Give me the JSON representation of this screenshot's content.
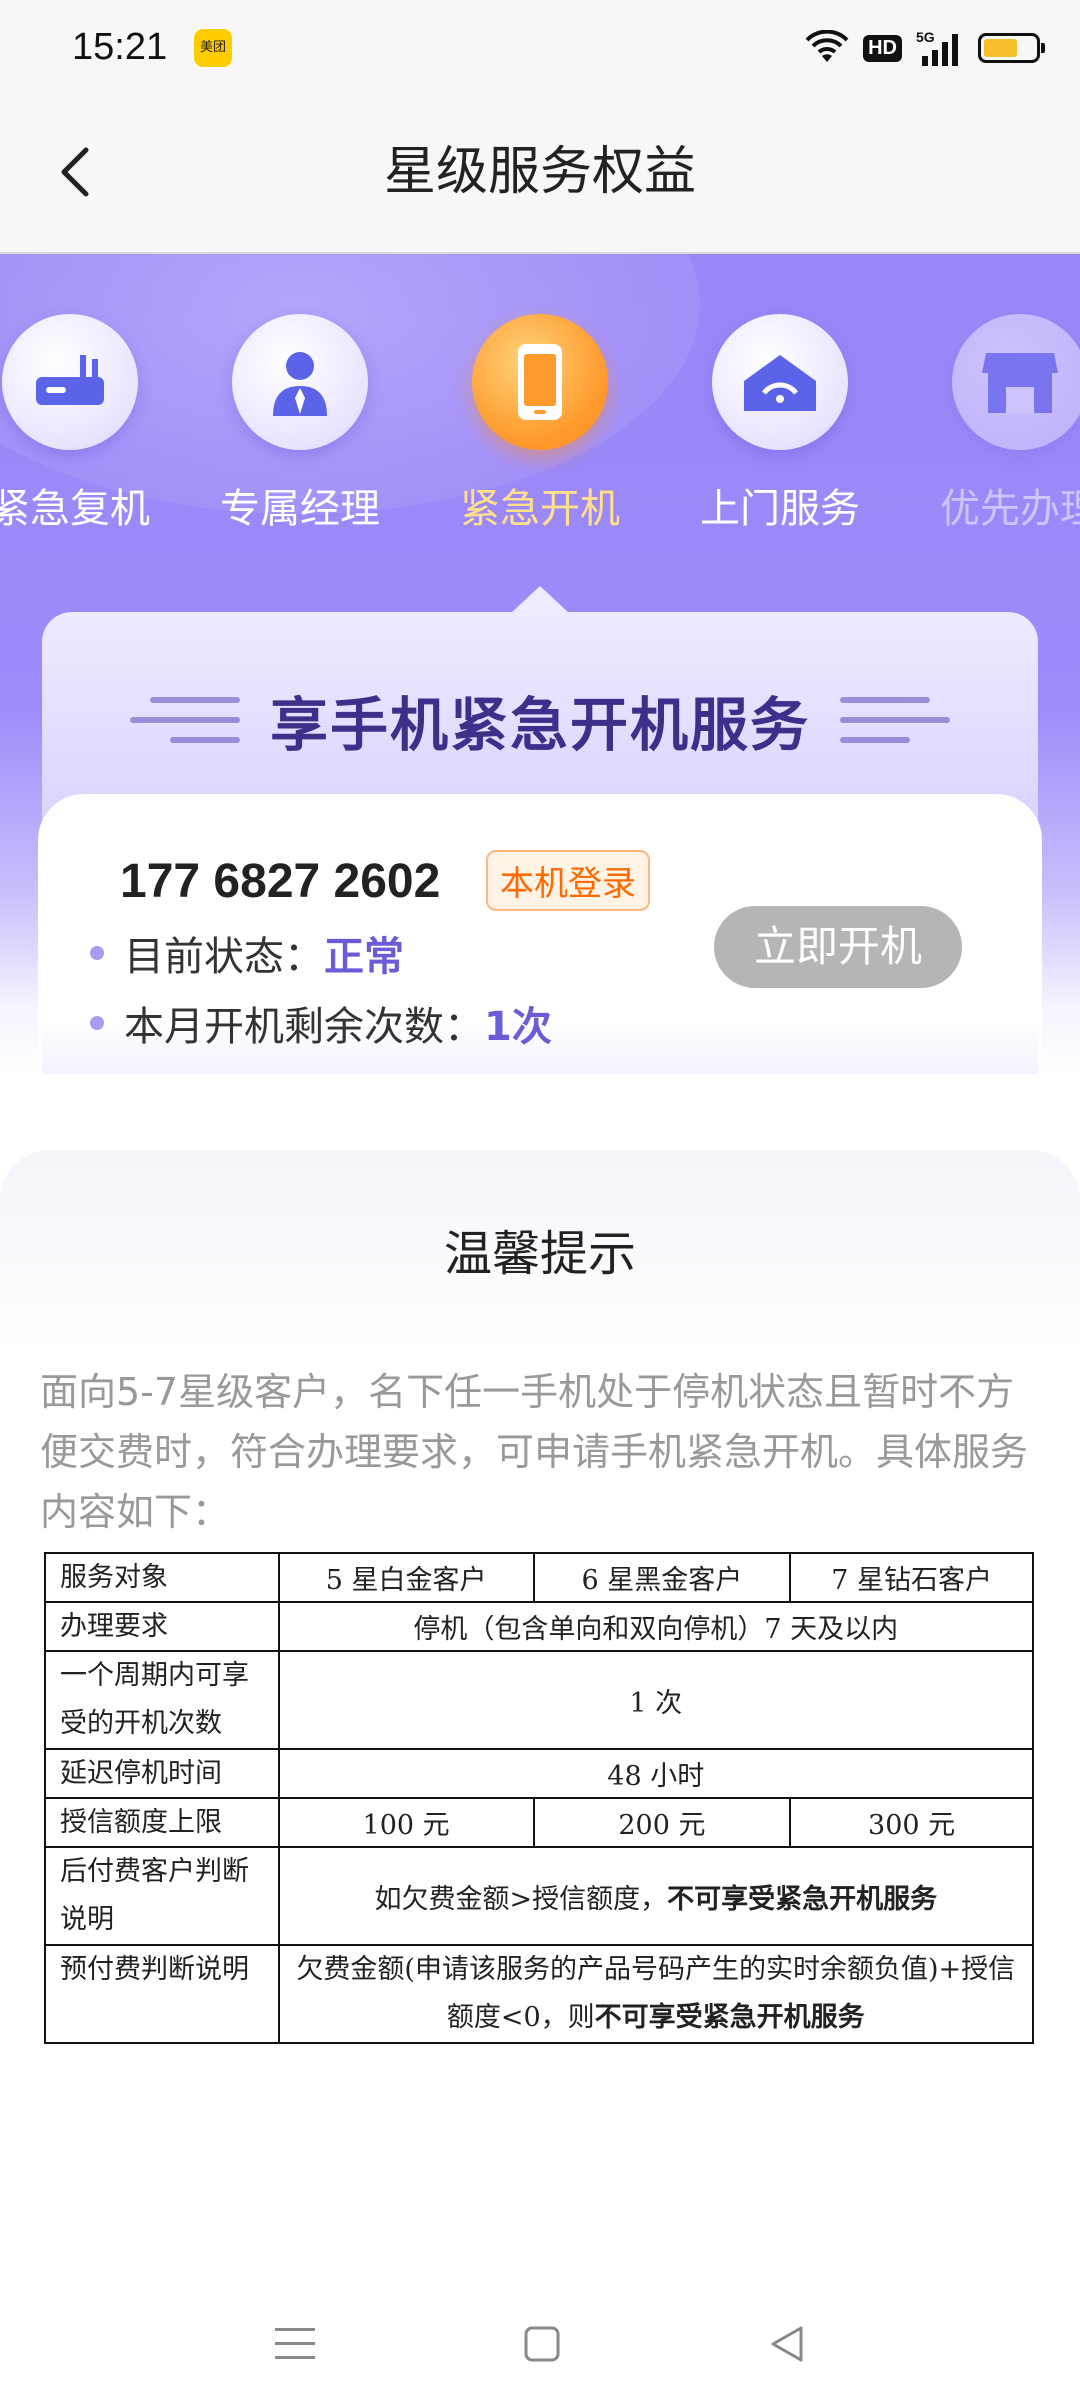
{
  "status_bar": {
    "time": "15:21",
    "app_badge": "美团",
    "hd": "HD",
    "network": "5G",
    "battery_level": 0.65
  },
  "nav": {
    "title": "星级服务权益"
  },
  "services": [
    {
      "label": "紧急复机",
      "icon": "router-icon"
    },
    {
      "label": "专属经理",
      "icon": "manager-icon"
    },
    {
      "label": "紧急开机",
      "icon": "phone-icon"
    },
    {
      "label": "上门服务",
      "icon": "home-service-icon"
    },
    {
      "label": "优先办理",
      "icon": "store-icon"
    }
  ],
  "benefit": {
    "title": "享手机紧急开机服务"
  },
  "account": {
    "phone": "177 6827 2602",
    "login_badge": "本机登录",
    "status_label": "目前状态：",
    "status_value": "正常",
    "remaining_label": "本月开机剩余次数：",
    "remaining_value": "1次",
    "open_button": "立即开机"
  },
  "tips": {
    "title": "温馨提示",
    "description": "面向5-7星级客户，名下任一手机处于停机状态且暂时不方便交费时，符合办理要求，可申请手机紧急开机。具体服务内容如下：",
    "table": {
      "row1": {
        "label": "服务对象",
        "c1": "5 星白金客户",
        "c2": "6 星黑金客户",
        "c3": "7 星钻石客户"
      },
      "row2": {
        "label": "办理要求",
        "value": "停机（包含单向和双向停机）7 天及以内"
      },
      "row3": {
        "label": "一个周期内可享受的开机次数",
        "value": "1 次"
      },
      "row4": {
        "label": "延迟停机时间",
        "value": "48 小时"
      },
      "row5": {
        "label": "授信额度上限",
        "c1": "100 元",
        "c2": "200 元",
        "c3": "300 元"
      },
      "row6": {
        "label": "后付费客户判断说明",
        "value_prefix": "如欠费金额>授信额度，",
        "value_bold": "不可享受紧急开机服务"
      },
      "row7": {
        "label": "预付费判断说明",
        "value_prefix": "欠费金额(申请该服务的产品号码产生的实时余额负值)+授信额度<0，则",
        "value_bold": "不可享受紧急开机服务"
      }
    }
  },
  "colors": {
    "accent": "#6a5bd6",
    "active": "#ff9b2e",
    "badge": "#ff6a00"
  }
}
